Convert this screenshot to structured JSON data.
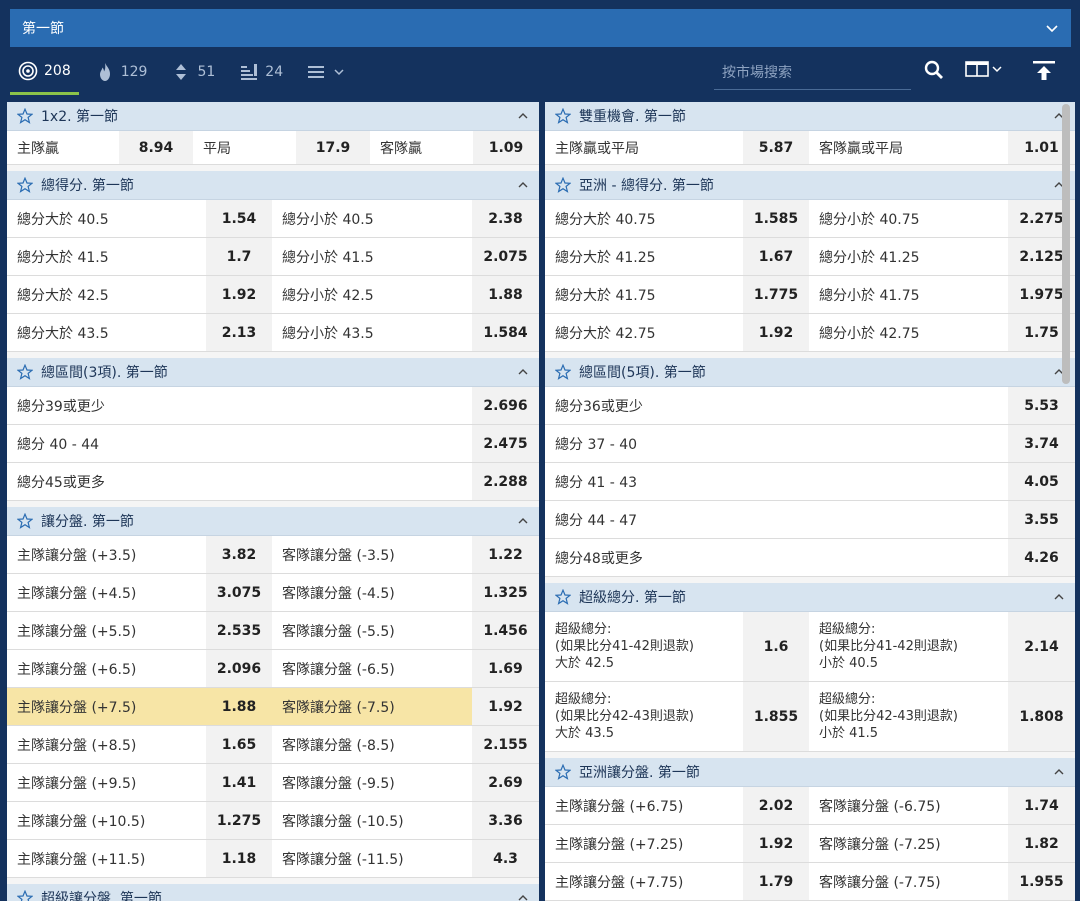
{
  "period": {
    "label": "第一節"
  },
  "toolbar": {
    "filters": [
      {
        "icon": "target-icon",
        "count": "208"
      },
      {
        "icon": "fire-icon",
        "count": "129"
      },
      {
        "icon": "sort-icon",
        "count": "51"
      },
      {
        "icon": "bars-icon",
        "count": "24"
      }
    ],
    "search_placeholder": "按市場搜索"
  },
  "left": [
    {
      "title": "1x2. 第一節",
      "type": "three",
      "rows": [
        {
          "a": "主隊贏",
          "ao": "8.94",
          "b": "平局",
          "bo": "17.9",
          "c": "客隊贏",
          "co": "1.09"
        }
      ]
    },
    {
      "title": "總得分. 第一節",
      "type": "two",
      "rows": [
        {
          "a": "總分大於 40.5",
          "ao": "1.54",
          "b": "總分小於 40.5",
          "bo": "2.38"
        },
        {
          "a": "總分大於 41.5",
          "ao": "1.7",
          "b": "總分小於 41.5",
          "bo": "2.075"
        },
        {
          "a": "總分大於 42.5",
          "ao": "1.92",
          "b": "總分小於 42.5",
          "bo": "1.88"
        },
        {
          "a": "總分大於 43.5",
          "ao": "2.13",
          "b": "總分小於 43.5",
          "bo": "1.584"
        }
      ]
    },
    {
      "title": "總區間(3項). 第一節",
      "type": "one",
      "rows": [
        {
          "a": "總分39或更少",
          "ao": "2.696"
        },
        {
          "a": "總分 40 - 44",
          "ao": "2.475"
        },
        {
          "a": "總分45或更多",
          "ao": "2.288"
        }
      ]
    },
    {
      "title": "讓分盤. 第一節",
      "type": "two",
      "rows": [
        {
          "a": "主隊讓分盤 (+3.5)",
          "ao": "3.82",
          "b": "客隊讓分盤 (-3.5)",
          "bo": "1.22"
        },
        {
          "a": "主隊讓分盤 (+4.5)",
          "ao": "3.075",
          "b": "客隊讓分盤 (-4.5)",
          "bo": "1.325"
        },
        {
          "a": "主隊讓分盤 (+5.5)",
          "ao": "2.535",
          "b": "客隊讓分盤 (-5.5)",
          "bo": "1.456"
        },
        {
          "a": "主隊讓分盤 (+6.5)",
          "ao": "2.096",
          "b": "客隊讓分盤 (-6.5)",
          "bo": "1.69"
        },
        {
          "a": "主隊讓分盤 (+7.5)",
          "ao": "1.88",
          "b": "客隊讓分盤 (-7.5)",
          "bo": "1.92",
          "hl": true
        },
        {
          "a": "主隊讓分盤 (+8.5)",
          "ao": "1.65",
          "b": "客隊讓分盤 (-8.5)",
          "bo": "2.155"
        },
        {
          "a": "主隊讓分盤 (+9.5)",
          "ao": "1.41",
          "b": "客隊讓分盤 (-9.5)",
          "bo": "2.69"
        },
        {
          "a": "主隊讓分盤 (+10.5)",
          "ao": "1.275",
          "b": "客隊讓分盤 (-10.5)",
          "bo": "3.36"
        },
        {
          "a": "主隊讓分盤 (+11.5)",
          "ao": "1.18",
          "b": "客隊讓分盤 (-11.5)",
          "bo": "4.3"
        }
      ]
    },
    {
      "title": "超級讓分盤. 第一節",
      "type": "two",
      "rows": []
    }
  ],
  "right": [
    {
      "title": "雙重機會. 第一節",
      "type": "two",
      "rows": [
        {
          "a": "主隊贏或平局",
          "ao": "5.87",
          "b": "客隊贏或平局",
          "bo": "1.01"
        }
      ]
    },
    {
      "title": "亞洲 - 總得分. 第一節",
      "type": "two",
      "rows": [
        {
          "a": "總分大於 40.75",
          "ao": "1.585",
          "b": "總分小於 40.75",
          "bo": "2.275"
        },
        {
          "a": "總分大於 41.25",
          "ao": "1.67",
          "b": "總分小於 41.25",
          "bo": "2.125"
        },
        {
          "a": "總分大於 41.75",
          "ao": "1.775",
          "b": "總分小於 41.75",
          "bo": "1.975"
        },
        {
          "a": "總分大於 42.75",
          "ao": "1.92",
          "b": "總分小於 42.75",
          "bo": "1.75"
        }
      ]
    },
    {
      "title": "總區間(5項). 第一節",
      "type": "one",
      "rows": [
        {
          "a": "總分36或更少",
          "ao": "5.53"
        },
        {
          "a": "總分 37 - 40",
          "ao": "3.74"
        },
        {
          "a": "總分 41 - 43",
          "ao": "4.05"
        },
        {
          "a": "總分 44 - 47",
          "ao": "3.55"
        },
        {
          "a": "總分48或更多",
          "ao": "4.26"
        }
      ]
    },
    {
      "title": "超級總分. 第一節",
      "type": "two",
      "tall": true,
      "rows": [
        {
          "a": "超級總分:\n(如果比分41-42則退款)\n大於 42.5",
          "ao": "1.6",
          "b": "超級總分:\n(如果比分41-42則退款)\n小於 40.5",
          "bo": "2.14"
        },
        {
          "a": "超級總分:\n(如果比分42-43則退款)\n大於 43.5",
          "ao": "1.855",
          "b": "超級總分:\n(如果比分42-43則退款)\n小於 41.5",
          "bo": "1.808"
        }
      ]
    },
    {
      "title": "亞洲讓分盤. 第一節",
      "type": "two",
      "rows": [
        {
          "a": "主隊讓分盤 (+6.75)",
          "ao": "2.02",
          "b": "客隊讓分盤 (-6.75)",
          "bo": "1.74"
        },
        {
          "a": "主隊讓分盤 (+7.25)",
          "ao": "1.92",
          "b": "客隊讓分盤 (-7.25)",
          "bo": "1.82"
        },
        {
          "a": "主隊讓分盤 (+7.75)",
          "ao": "1.79",
          "b": "客隊讓分盤 (-7.75)",
          "bo": "1.955"
        }
      ]
    }
  ]
}
